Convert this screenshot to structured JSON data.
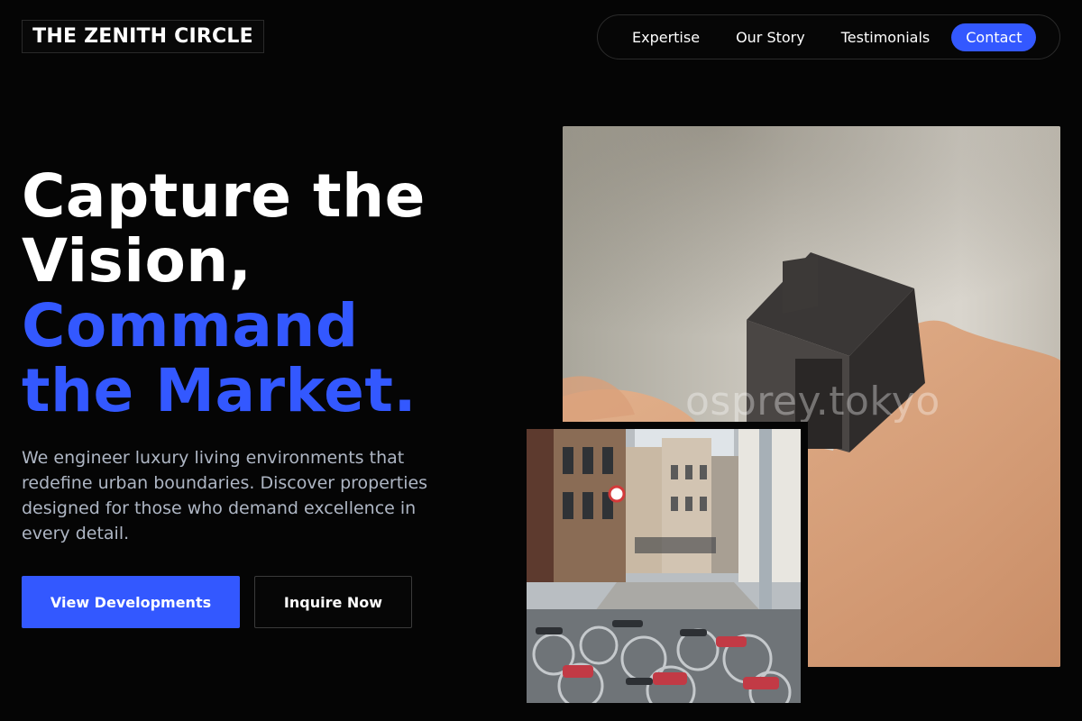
{
  "header": {
    "logo": "THE ZENITH CIRCLE",
    "nav": [
      {
        "label": "Expertise"
      },
      {
        "label": "Our Story"
      },
      {
        "label": "Testimonials"
      },
      {
        "label": "Contact",
        "active": true
      }
    ]
  },
  "hero": {
    "title_line1": "Capture the",
    "title_line2": "Vision,",
    "title_line3": "Command",
    "title_line4": "the Market.",
    "description": "We engineer luxury living environments that redefine urban boundaries. Discover properties designed for those who demand excellence in every detail.",
    "primary_button": "View Developments",
    "secondary_button": "Inquire Now"
  },
  "images": {
    "house_watermark": "osprey.tokyo"
  },
  "colors": {
    "accent": "#3358ff",
    "background": "#050505",
    "body_text": "#aeb6c4"
  }
}
